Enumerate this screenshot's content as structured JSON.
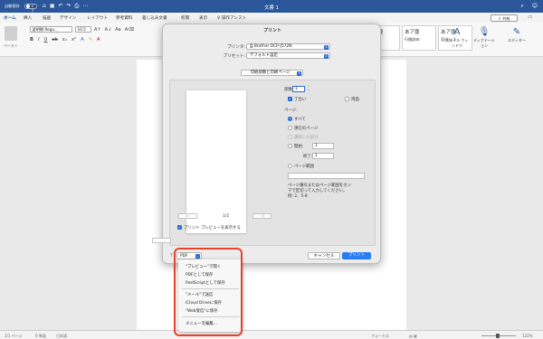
{
  "titlebar": {
    "autosave_label": "自動保存",
    "autosave_state": "オフ",
    "document_title": "文書 1"
  },
  "tabs": [
    "ホーム",
    "挿入",
    "描画",
    "デザイン",
    "レイアウト",
    "参考資料",
    "差し込み文書",
    "校閲",
    "表示",
    "操作アシスト"
  ],
  "tab_share": "共有",
  "ribbon": {
    "paste_label": "ペースト",
    "font_name": "游明朝 Regu...",
    "font_size": "10.5",
    "styles": [
      {
        "preview": "あア亜",
        "label": "標準"
      },
      {
        "preview": "あア亜",
        "label": "行間詰め"
      },
      {
        "preview": "あア亜",
        "label": "見出し 1"
      }
    ],
    "styles_pane_label": "スタイル ウィンドウ",
    "dictation_label": "ディクテーション",
    "editor_label": "エディター"
  },
  "print_dialog": {
    "title": "プリント",
    "printer_label": "プリンタ:",
    "printer_value": "Brother DCP-J572N",
    "preset_label": "プリセット:",
    "preset_value": "デフォルト設定",
    "section_value": "印刷部数と印刷ページ",
    "copies_label": "部数:",
    "copies_value": "1",
    "collate_label": "丁合い",
    "duplex_label": "両面",
    "pages_label": "ページ:",
    "all_label": "すべて",
    "current_page_label": "現在のページ",
    "selection_label": "選択した部分",
    "from_label": "開始:",
    "from_value": "1",
    "to_label": "終了:",
    "to_value": "1",
    "page_range_label": "ページ範囲",
    "range_help_1": "ページ番号またはページ範囲をカン",
    "range_help_2": "マで区切って入力してください。",
    "range_help_3": "例: 2、5-8",
    "prev_nav": "≪ ‹",
    "next_nav": "› ≫",
    "page_of": "1/1",
    "show_preview_label": "プリント プレビューを表示する",
    "help": "?",
    "pdf_label": "PDF",
    "cancel_label": "キャンセル",
    "print_label": "プリント"
  },
  "pdf_menu": {
    "items_group1": [
      "\"プレビュー\"で開く",
      "PDFとして保存",
      "PostScriptとして保存"
    ],
    "items_group2": [
      "\"メール\"で送信",
      "iCloud Driveに保存",
      "\"Web受信\"に保存"
    ],
    "items_group3": [
      "メニューを編集..."
    ]
  },
  "status": {
    "page": "1/1 ページ",
    "words": "0 単語",
    "language": "日本語",
    "focus": "フォーカス",
    "zoom": "122%"
  },
  "colors": {
    "titlebar": "#2b579a",
    "accent_blue": "#2a6bd1",
    "print_button": "#2a7cf6",
    "highlight_red": "#e8412b"
  }
}
